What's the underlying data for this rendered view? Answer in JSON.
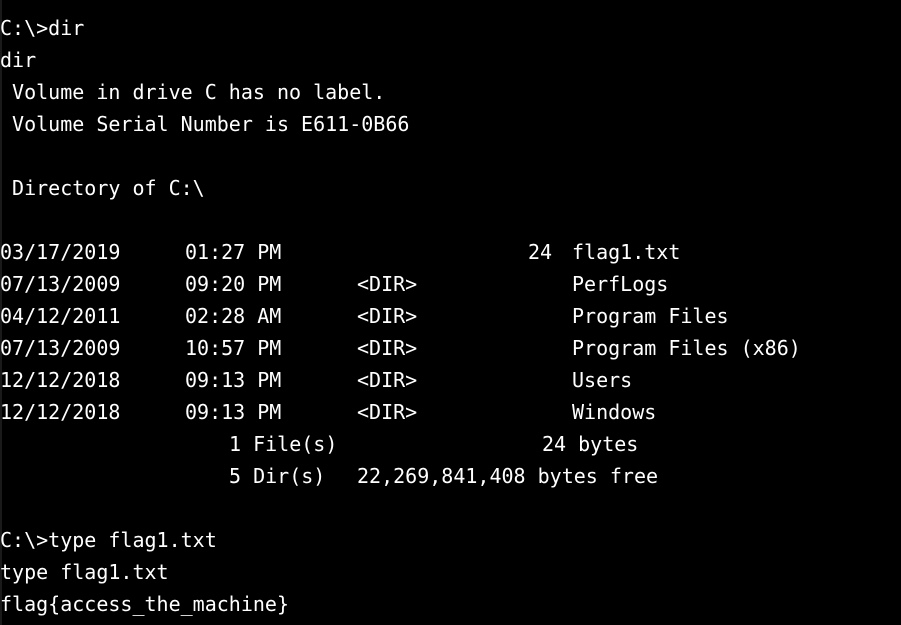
{
  "terminal": {
    "prompt1": "C:\\>dir",
    "echo1": "dir",
    "volume_label_line": " Volume in drive C has no label.",
    "serial_line": " Volume Serial Number is E611-0B66",
    "directory_line": " Directory of C:\\",
    "listing": [
      {
        "date": "03/17/2019",
        "time": "01:27 PM",
        "type": "",
        "size": "24",
        "name": "flag1.txt"
      },
      {
        "date": "07/13/2009",
        "time": "09:20 PM",
        "type": "<DIR>",
        "size": "",
        "name": "PerfLogs"
      },
      {
        "date": "04/12/2011",
        "time": "02:28 AM",
        "type": "<DIR>",
        "size": "",
        "name": "Program Files"
      },
      {
        "date": "07/13/2009",
        "time": "10:57 PM",
        "type": "<DIR>",
        "size": "",
        "name": "Program Files (x86)"
      },
      {
        "date": "12/12/2018",
        "time": "09:13 PM",
        "type": "<DIR>",
        "size": "",
        "name": "Users"
      },
      {
        "date": "12/12/2018",
        "time": "09:13 PM",
        "type": "<DIR>",
        "size": "",
        "name": "Windows"
      }
    ],
    "files_summary": "1 File(s)",
    "files_bytes": "24 bytes",
    "dirs_summary": "5 Dir(s)",
    "dirs_bytes": "22,269,841,408 bytes free",
    "prompt2": "C:\\>type flag1.txt",
    "echo2": "type flag1.txt",
    "output": "flag{access_the_machine}"
  },
  "colors": {
    "background": "#000000",
    "text": "#ffffff"
  }
}
